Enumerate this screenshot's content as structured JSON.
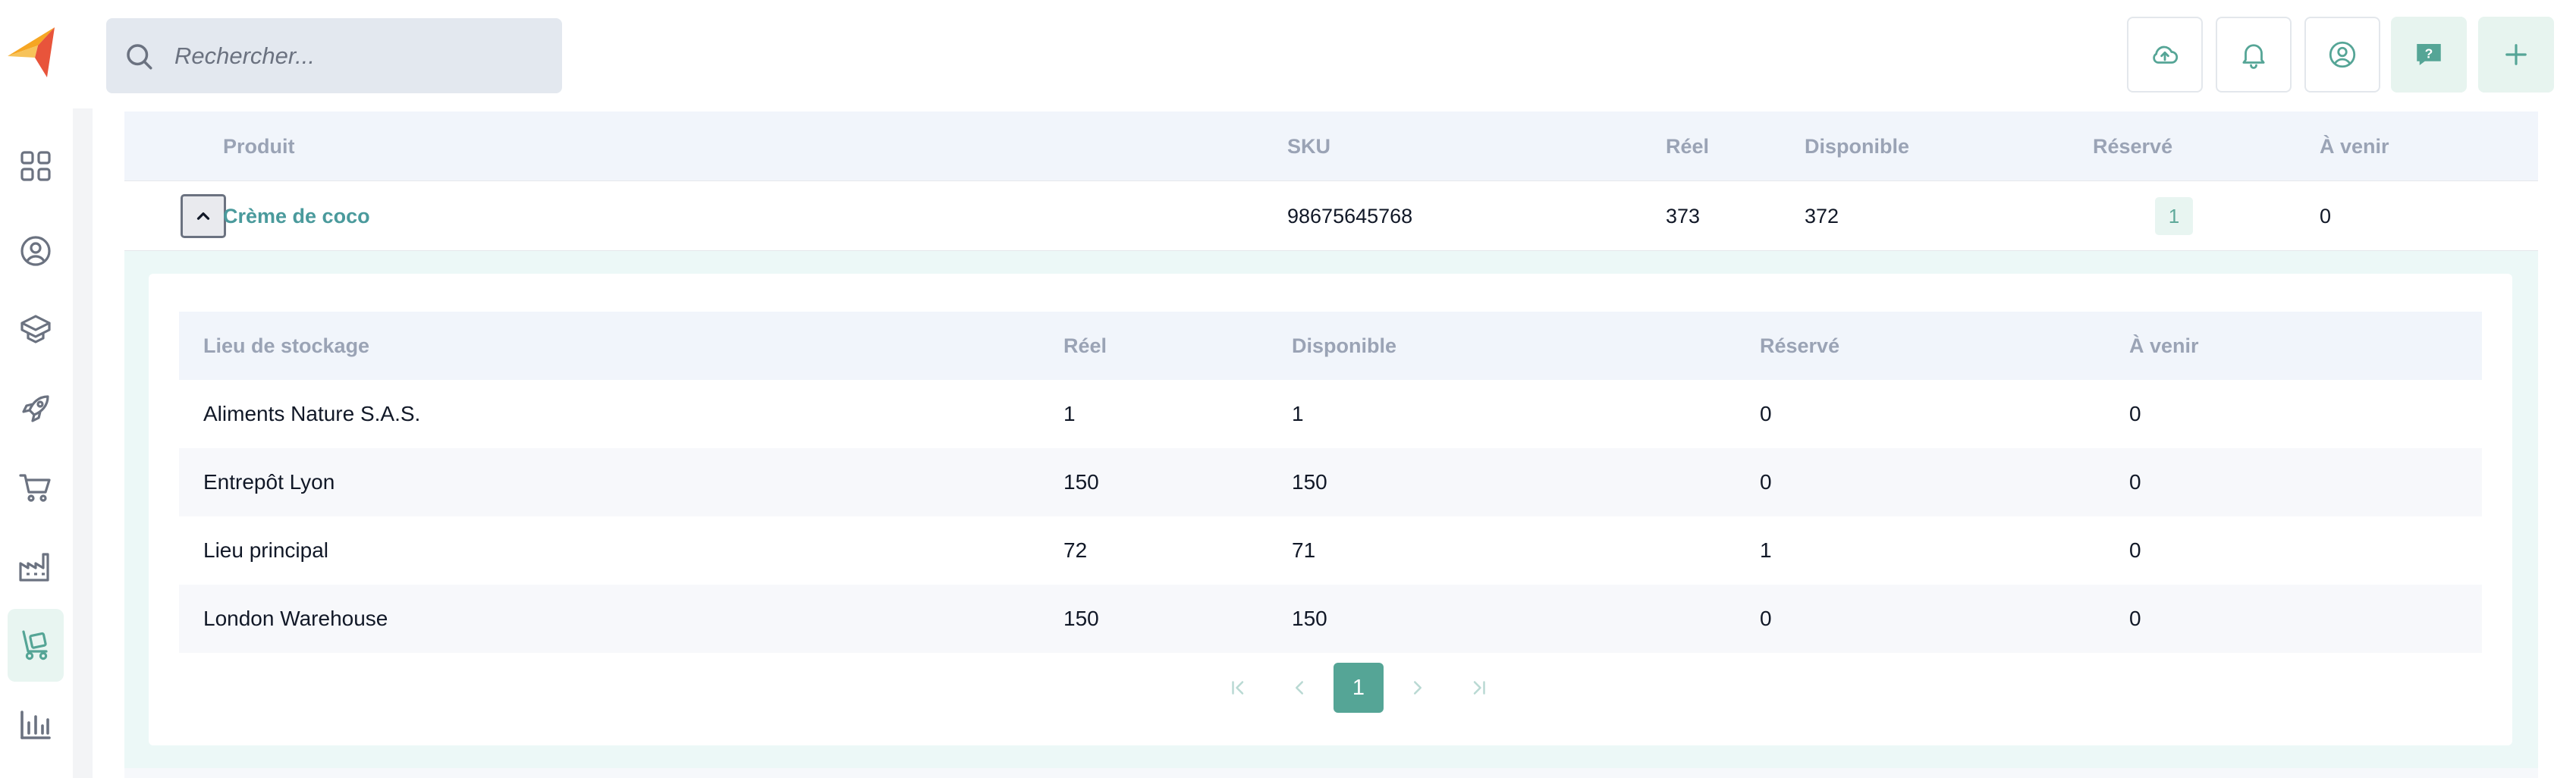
{
  "search": {
    "placeholder": "Rechercher..."
  },
  "outer_table": {
    "headers": {
      "product": "Produit",
      "sku": "SKU",
      "real": "Réel",
      "available": "Disponible",
      "reserved": "Réservé",
      "upcoming": "À venir"
    },
    "row": {
      "product": "Crème de coco",
      "sku": "98675645768",
      "real": "373",
      "available": "372",
      "reserved": "1",
      "upcoming": "0"
    }
  },
  "inner_table": {
    "headers": {
      "location": "Lieu de stockage",
      "real": "Réel",
      "available": "Disponible",
      "reserved": "Réservé",
      "upcoming": "À venir"
    },
    "rows": [
      {
        "location": "Aliments Nature S.A.S.",
        "real": "1",
        "available": "1",
        "reserved": "0",
        "upcoming": "0"
      },
      {
        "location": "Entrepôt Lyon",
        "real": "150",
        "available": "150",
        "reserved": "0",
        "upcoming": "0"
      },
      {
        "location": "Lieu principal",
        "real": "72",
        "available": "71",
        "reserved": "1",
        "upcoming": "0"
      },
      {
        "location": "London Warehouse",
        "real": "150",
        "available": "150",
        "reserved": "0",
        "upcoming": "0"
      }
    ]
  },
  "pagination": {
    "current_page": "1"
  },
  "colors": {
    "accent": "#55a596",
    "link": "#4a9a9c",
    "header_bg": "#f1f5fb",
    "expand_bg": "#ecf8f7"
  },
  "icons": {
    "topbar": [
      "cloud-upload-icon",
      "bell-icon",
      "user-circle-icon",
      "help-chat-icon",
      "plus-icon"
    ],
    "sidebar": [
      "dashboard-grid-icon",
      "contacts-icon",
      "products-box-icon",
      "launch-rocket-icon",
      "cart-icon",
      "factory-icon",
      "inventory-dolly-icon",
      "analytics-chart-icon"
    ]
  }
}
